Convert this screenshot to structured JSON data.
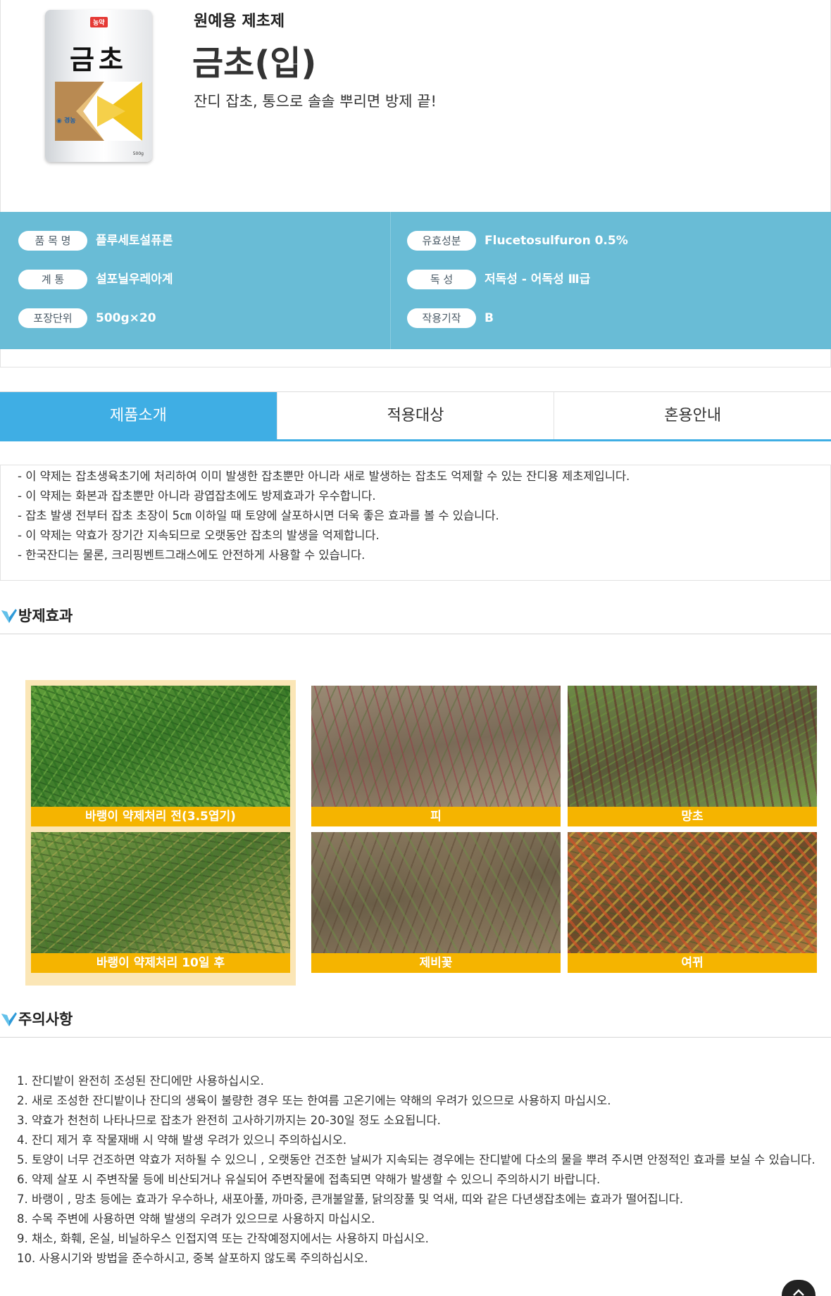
{
  "header": {
    "category": "원예용 제초제",
    "title": "금초(입)",
    "slogan": "잔디 잡초, 통으로 솔솔 뿌리면 방제 끝!",
    "package": {
      "label": "농약",
      "name": "금초",
      "brand": "경농",
      "weight": "500g"
    }
  },
  "info": {
    "left": [
      {
        "label": "품 목 명",
        "value": "플루세토설퓨론"
      },
      {
        "label": "계   통",
        "value": "설포닐우레아계"
      },
      {
        "label": "포장단위",
        "value": "500g×20"
      }
    ],
    "right": [
      {
        "label": "유효성분",
        "value": "Flucetosulfuron 0.5%"
      },
      {
        "label": "독   성",
        "value": "저독성 - 어독성 Ⅲ급"
      },
      {
        "label": "작용기작",
        "value": "B"
      }
    ]
  },
  "tabs": [
    {
      "label": "제품소개",
      "active": true
    },
    {
      "label": "적용대상",
      "active": false
    },
    {
      "label": "혼용안내",
      "active": false
    }
  ],
  "intro": [
    "- 이 약제는 잡초생육초기에 처리하여 이미 발생한 잡초뿐만 아니라 새로 발생하는 잡초도 억제할 수 있는 잔디용 제초제입니다.",
    "- 이 약제는 화본과 잡초뿐만 아니라 광엽잡초에도 방제효과가 우수합니다.",
    "- 잡초 발생 전부터 잡초 초장이 5㎝ 이하일 때 토양에 살포하시면 더욱 좋은 효과를 볼 수 있습니다.",
    "- 이 약제는 약효가 장기간 지속되므로 오랫동안 잡초의 발생을 억제합니다.",
    "- 한국잔디는 물론, 크리핑벤트그래스에도 안전하게 사용할 수 있습니다."
  ],
  "effect": {
    "title": "방제효과",
    "photos": [
      {
        "caption": "바랭이 약제처리 전(3.5엽기)"
      },
      {
        "caption": "피"
      },
      {
        "caption": "망초"
      },
      {
        "caption": "바랭이 약제처리 10일 후"
      },
      {
        "caption": "제비꽃"
      },
      {
        "caption": "여뀌"
      }
    ]
  },
  "caution": {
    "title": "주의사항",
    "items": [
      "1. 잔디밭이 완전히 조성된 잔디에만 사용하십시오.",
      "2. 새로 조성한 잔디밭이나 잔디의 생육이 불량한 경우 또는 한여름 고온기에는 약해의 우려가 있으므로 사용하지 마십시오.",
      "3. 약효가 천천히 나타나므로 잡초가 완전히 고사하기까지는 20-30일 정도 소요됩니다.",
      "4. 잔디 제거 후 작물재배 시 약해 발생 우려가 있으니 주의하십시오.",
      "5. 토양이 너무 건조하면 약효가 저하될 수 있으니 , 오랫동안 건조한 날씨가 지속되는 경우에는 잔디밭에 다소의 물을 뿌려 주시면 안정적인 효과를 보실 수 있습니다.",
      "6. 약제 살포 시 주변작물 등에 비산되거나 유실되어 주변작물에 접촉되면 약해가 발생할 수 있으니 주의하시기 바랍니다.",
      "7. 바랭이 , 망초 등에는 효과가 우수하나, 새포아풀, 까마중, 큰개불알풀, 닭의장풀 및 억새, 띠와 같은 다년생잡초에는 효과가 떨어집니다.",
      "8. 수목 주변에 사용하면 약해 발생의 우려가 있으므로 사용하지 마십시오.",
      "9. 채소, 화훼, 온실, 비닐하우스 인접지역 또는 간작예정지에서는 사용하지 마십시오.",
      "10. 사용시기와 방법을 준수하시고, 중복 살포하지 않도록 주의하십시오."
    ]
  },
  "colors": {
    "band": "#69bcd6",
    "tab_active": "#3faee4",
    "caption": "#f5b400",
    "frame": "#fbe6b6"
  },
  "icons": {
    "section": "blue-check-icon",
    "scroll_top": "chevron-up-icon"
  }
}
